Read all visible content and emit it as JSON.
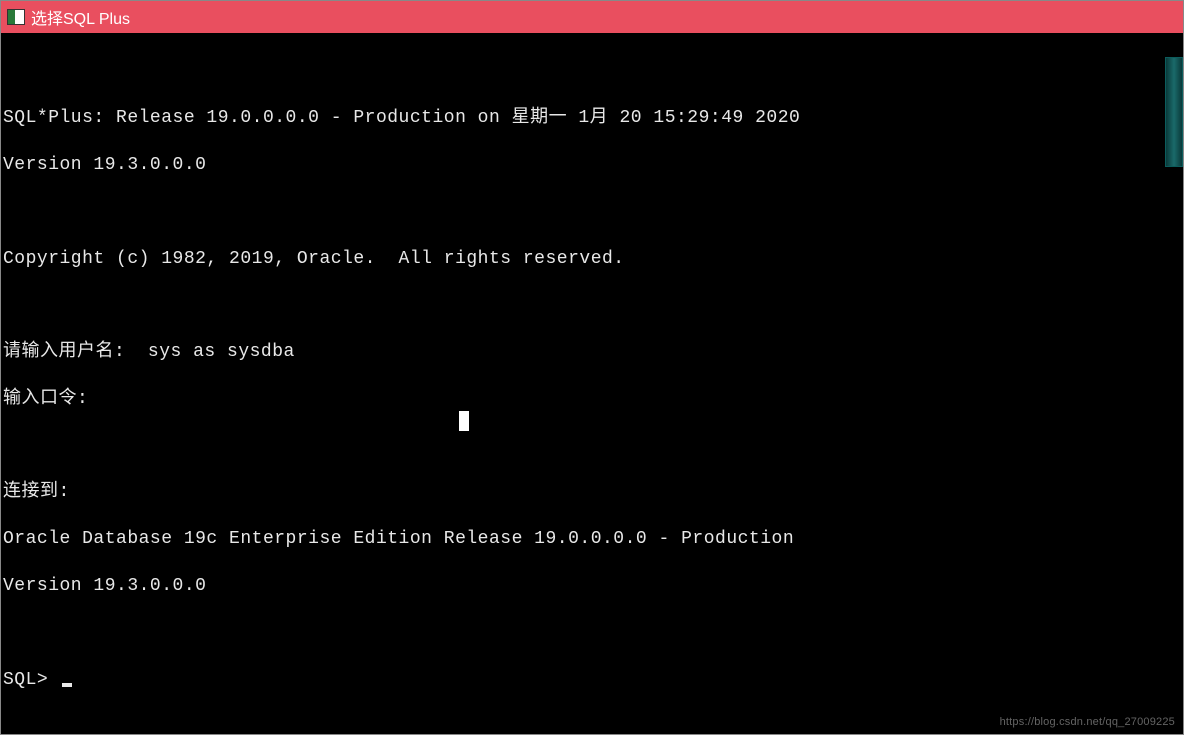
{
  "window": {
    "title": "选择SQL Plus"
  },
  "terminal": {
    "lines": {
      "blank0": "",
      "header": "SQL*Plus: Release 19.0.0.0.0 - Production on 星期一 1月 20 15:29:49 2020",
      "version1": "Version 19.3.0.0.0",
      "blank1": "",
      "copyright": "Copyright (c) 1982, 2019, Oracle.  All rights reserved.",
      "blank2": "",
      "username_prompt": "请输入用户名:  sys as sysdba",
      "password_prompt": "输入口令:",
      "blank3": "",
      "connected": "连接到:",
      "db_info": "Oracle Database 19c Enterprise Edition Release 19.0.0.0.0 - Production",
      "version2": "Version 19.3.0.0.0",
      "blank4": "",
      "sql_prompt": "SQL> "
    }
  },
  "watermark": "https://blog.csdn.net/qq_27009225"
}
